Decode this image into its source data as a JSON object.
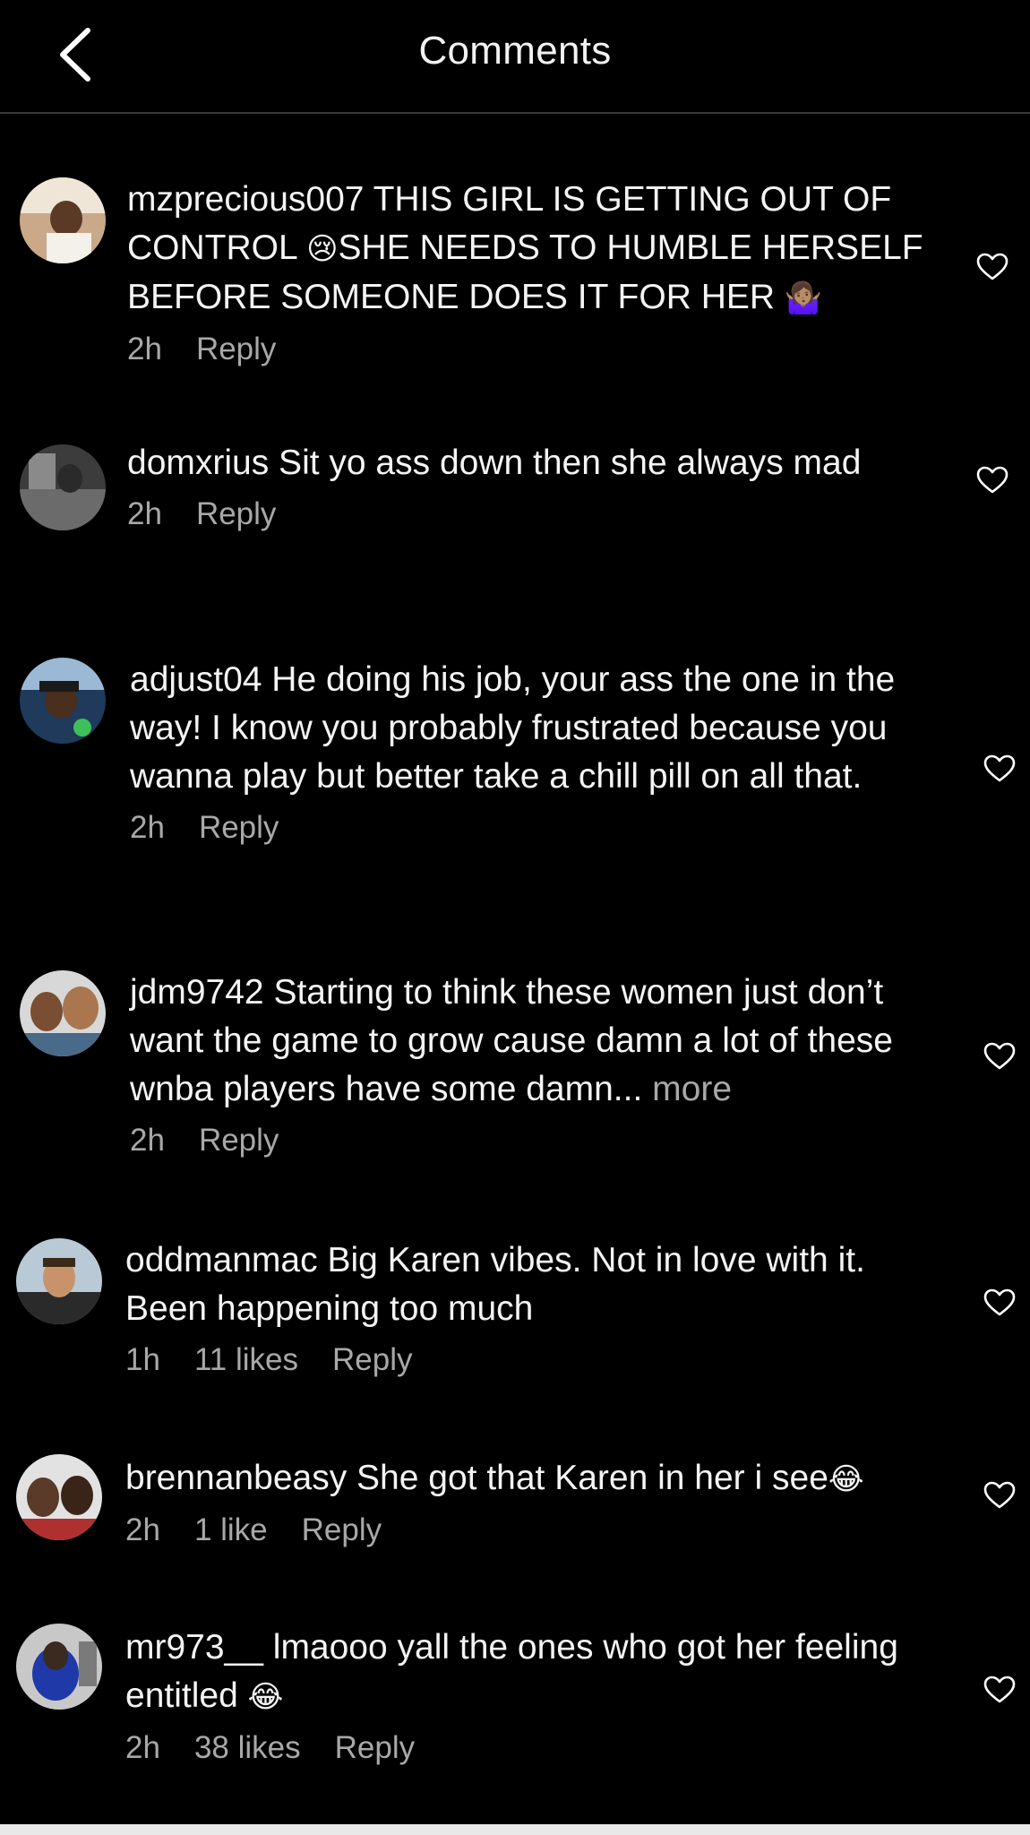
{
  "header": {
    "title": "Comments",
    "back_icon": "chevron-left-icon"
  },
  "comments": [
    {
      "username": "mzprecious007",
      "text_a": " THIS GIRL IS GETTING OUT OF CONTROL ",
      "emoji_a": "😢",
      "text_b": "SHE NEEDS TO HUMBLE HERSELF BEFORE SOMEONE DOES IT FOR HER ",
      "emoji_b": "🤷🏽‍♀️",
      "time": "2h",
      "reply": "Reply"
    },
    {
      "username": "domxrius",
      "text": " Sit yo ass down then she always mad",
      "time": "2h",
      "reply": "Reply"
    },
    {
      "username": "adjust04",
      "text": " He doing his job, your ass the one in the way! I know you probably frustrated because you wanna play but better take a chill pill on all that.",
      "time": "2h",
      "reply": "Reply"
    },
    {
      "username": "jdm9742",
      "text": " Starting to think these women just don’t want the game to grow cause damn a lot of these wnba players have some damn...",
      "more": " more",
      "time": "2h",
      "reply": "Reply"
    },
    {
      "username": "oddmanmac",
      "text": " Big Karen vibes. Not in love with it. Been happening too much",
      "time": "1h",
      "likes": "11 likes",
      "reply": "Reply"
    },
    {
      "username": "brennanbeasy",
      "text": " She got that Karen in her i see",
      "emoji": "😂",
      "time": "2h",
      "likes": "1 like",
      "reply": "Reply"
    },
    {
      "username": "mr973__",
      "text": " lmaooo yall the ones who got her feeling entitled ",
      "emoji": "😂",
      "time": "2h",
      "likes": "38 likes",
      "reply": "Reply"
    }
  ],
  "icons": {
    "like": "heart-outline-icon"
  },
  "colors": {
    "background": "#000000",
    "text": "#f4f4f4",
    "secondary": "#a8a8a8",
    "divider": "#3a3a3a"
  }
}
